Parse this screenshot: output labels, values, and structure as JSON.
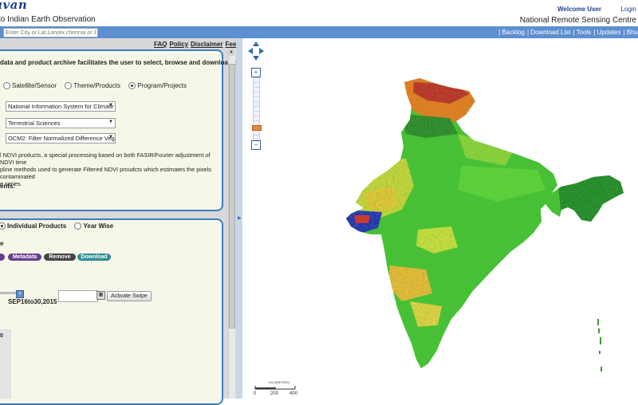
{
  "header": {
    "logo_text": "uvan",
    "subtitle": "to Indian Earth Observation",
    "welcome": "Welcome User",
    "login": "Login",
    "org": "National Remote Sensing Centre"
  },
  "search": {
    "placeholder": "Enter City or Lat,Lon(ex.chennai or 1"
  },
  "nav": {
    "items": [
      "| Backlog",
      "| Download List",
      "| Tools",
      "| Updates",
      "| Bhu"
    ]
  },
  "toplinks": [
    "FAQ",
    "Policy",
    "Disclaimer",
    "Feedback"
  ],
  "panel1": {
    "intro": "data and product archive facilitates the user to select, browse and download data",
    "radios": [
      {
        "label": "Satellite/Sensor",
        "selected": false
      },
      {
        "label": "Theme/Products",
        "selected": false
      },
      {
        "label": "Program/Projects",
        "selected": true
      }
    ],
    "program_select": "National Information System for Climate",
    "theme_select": "Terrestrial Sciences",
    "product_select": "OCM2: Filter Normalized Difference Vege",
    "description_lines": [
      "l NDVI products, a special processing based on both FASIR/Fourier adjustment of NDVI time",
      "pline methods used to generate Filtered NDVI proudcts which estimates the pixels contaminated",
      "e series."
    ],
    "components_label": "ents:"
  },
  "panel2": {
    "radios": [
      {
        "label": "Individual Products",
        "selected": true
      },
      {
        "label": "Year Wise",
        "selected": false
      }
    ],
    "e_label": "e",
    "buttons": {
      "metadata": "Metadata",
      "remove": "Remove",
      "download": "Download"
    },
    "date_label": "SEP16to30,2015",
    "swipe_button": "Activate Swipe",
    "side_number": "0"
  },
  "map": {
    "scale_label": "KILOMETERS",
    "scale_ticks": [
      "0",
      "200",
      "400"
    ]
  },
  "colors": {
    "brand_blue": "#5d8fd1",
    "panel_border": "#3c7fbc",
    "metadata_btn": "#6a3d8f",
    "remove_btn": "#444444",
    "download_btn": "#2e8c95",
    "ndvi_green": "#3fbf2f"
  }
}
